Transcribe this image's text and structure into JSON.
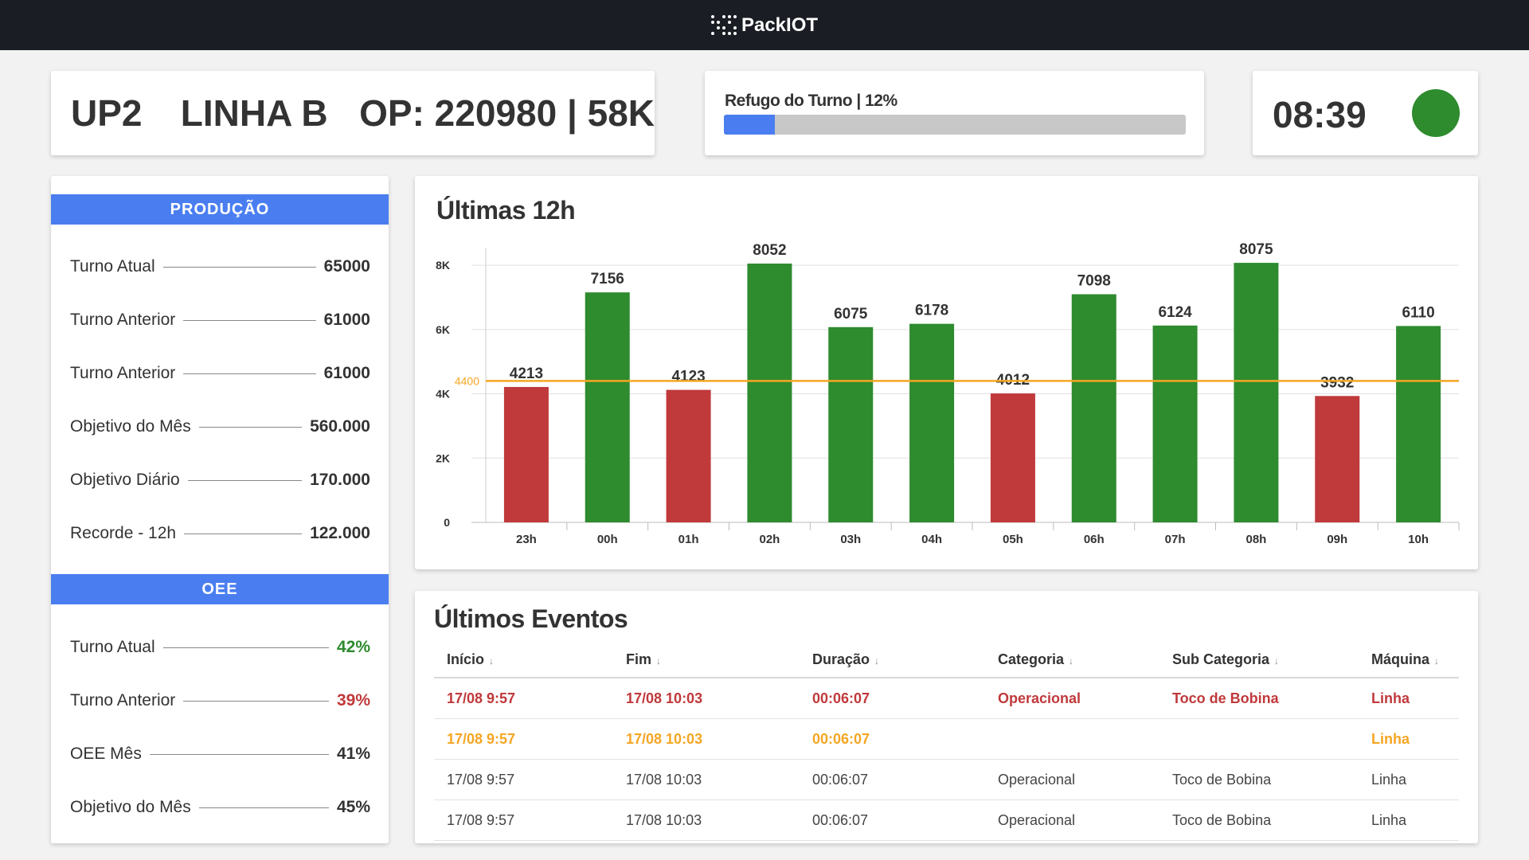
{
  "app": {
    "logo_text": "PackIOT"
  },
  "header": {
    "unit": "UP2",
    "line": "LINHA B",
    "op": "OP: 220980 | 58K"
  },
  "refugo": {
    "label": "Refugo do Turno | 12%",
    "progress": 0.11
  },
  "clock": {
    "time": "08:39",
    "status_color": "#2e8b2e"
  },
  "producao": {
    "title": "PRODUÇÃO",
    "items": [
      {
        "label": "Turno Atual",
        "value": "65000"
      },
      {
        "label": "Turno Anterior",
        "value": "61000"
      },
      {
        "label": "Turno Anterior",
        "value": "61000"
      },
      {
        "label": "Objetivo do Mês",
        "value": "560.000"
      },
      {
        "label": "Objetivo Diário",
        "value": "170.000"
      },
      {
        "label": "Recorde - 12h",
        "value": "122.000"
      }
    ]
  },
  "oee": {
    "title": "OEE",
    "items": [
      {
        "label": "Turno Atual",
        "value": "42%",
        "color": "green"
      },
      {
        "label": "Turno Anterior",
        "value": "39%",
        "color": "red"
      },
      {
        "label": "OEE Mês",
        "value": "41%",
        "color": ""
      },
      {
        "label": "Objetivo do Mês",
        "value": "45%",
        "color": ""
      }
    ]
  },
  "chart_title": "Últimas 12h",
  "chart_data": {
    "type": "bar",
    "categories": [
      "23h",
      "00h",
      "01h",
      "02h",
      "03h",
      "04h",
      "05h",
      "06h",
      "07h",
      "08h",
      "09h",
      "10h"
    ],
    "values": [
      4213,
      7156,
      4123,
      8052,
      6075,
      6178,
      4012,
      7098,
      6124,
      8075,
      3932,
      6110
    ],
    "target": 4400,
    "target_label": "4400",
    "ylim": [
      0,
      8300
    ],
    "yticks": [
      0,
      2000,
      4000,
      6000,
      8000
    ],
    "ytick_labels": [
      "0",
      "2K",
      "4K",
      "6K",
      "8K"
    ],
    "colors": {
      "above": "#2e8b2e",
      "below": "#c0393b",
      "target": "#f5a623"
    },
    "grid": true
  },
  "events": {
    "title": "Últimos Eventos",
    "columns": [
      "Início",
      "Fim",
      "Duração",
      "Categoria",
      "Sub Categoria",
      "Máquina"
    ],
    "rows": [
      {
        "style": "red",
        "cells": [
          "17/08 9:57",
          "17/08 10:03",
          "00:06:07",
          "Operacional",
          "Toco de Bobina",
          "Linha"
        ]
      },
      {
        "style": "orange",
        "cells": [
          "17/08 9:57",
          "17/08 10:03",
          "00:06:07",
          "",
          "",
          "Linha"
        ]
      },
      {
        "style": "plain",
        "cells": [
          "17/08 9:57",
          "17/08 10:03",
          "00:06:07",
          "Operacional",
          "Toco de Bobina",
          "Linha"
        ]
      },
      {
        "style": "plain",
        "cells": [
          "17/08 9:57",
          "17/08 10:03",
          "00:06:07",
          "Operacional",
          "Toco de Bobina",
          "Linha"
        ]
      }
    ]
  }
}
